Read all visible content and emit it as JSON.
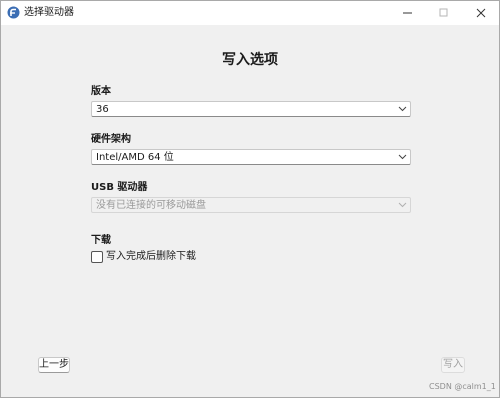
{
  "window": {
    "title": "选择驱动器",
    "icon": "fedora-media-writer-icon",
    "controls": {
      "minimize": "minimize-icon",
      "maximize": "maximize-icon",
      "close": "close-icon"
    }
  },
  "heading": "写入选项",
  "version": {
    "label": "版本",
    "value": "36"
  },
  "architecture": {
    "label": "硬件架构",
    "value": "Intel/AMD 64 位"
  },
  "usb_drive": {
    "label": "USB 驱动器",
    "placeholder": "没有已连接的可移动磁盘",
    "enabled": false
  },
  "download": {
    "label": "下载",
    "delete_after_write_label": "写入完成后删除下载",
    "delete_after_write_checked": false
  },
  "buttons": {
    "back": "上一步",
    "write": "写入",
    "write_enabled": false
  },
  "watermark": "CSDN @calm1_1",
  "colors": {
    "window_bg": "#f0f0f0",
    "titlebar_bg": "#ffffff",
    "disabled_text": "#9a9a9a"
  }
}
